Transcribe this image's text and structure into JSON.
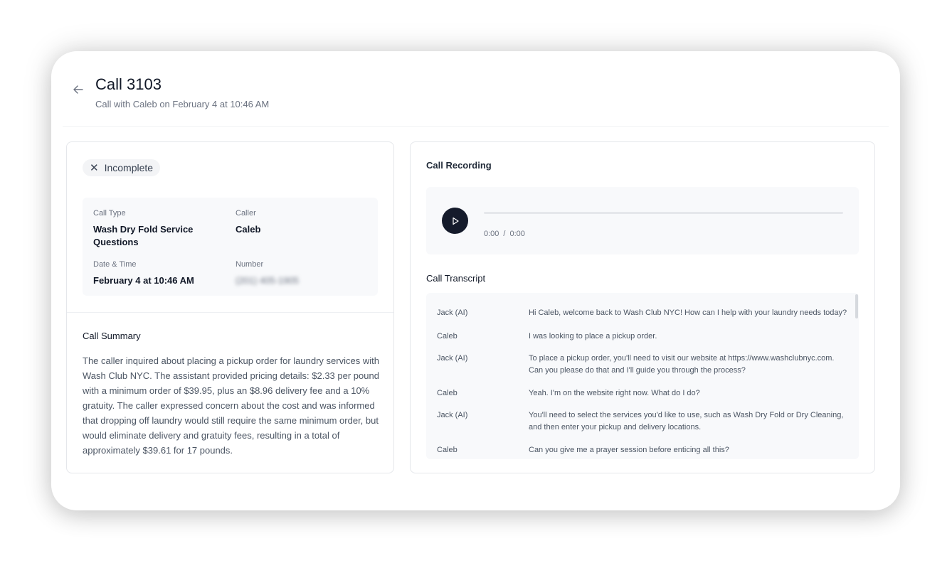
{
  "header": {
    "title": "Call 3103",
    "subtitle": "Call with Caleb on February 4 at 10:46 AM"
  },
  "status": {
    "label": "Incomplete"
  },
  "details": {
    "call_type_label": "Call Type",
    "call_type_value": "Wash Dry Fold Service Questions",
    "caller_label": "Caller",
    "caller_value": "Caleb",
    "datetime_label": "Date & Time",
    "datetime_value": "February 4 at 10:46 AM",
    "number_label": "Number",
    "number_value": "(201) 405-1905"
  },
  "summary": {
    "title": "Call Summary",
    "text": "The caller inquired about placing a pickup order for laundry services with Wash Club NYC. The assistant provided pricing details: $2.33 per pound with a minimum order of $39.95, plus an $8.96 delivery fee and a 10% gratuity. The caller expressed concern about the cost and was informed that dropping off laundry would still require the same minimum order, but would eliminate delivery and gratuity fees, resulting in a total of approximately $39.61 for 17 pounds."
  },
  "recording": {
    "title": "Call Recording",
    "current_time": "0:00",
    "separator": "/",
    "duration": "0:00",
    "progress": 0
  },
  "transcript": {
    "title": "Call Transcript",
    "rows": [
      {
        "speaker": "Jack (AI)",
        "text": "Hi Caleb, welcome back to Wash Club NYC! How can I help with your laundry needs today?"
      },
      {
        "speaker": "Caleb",
        "text": "I was looking to place a pickup order."
      },
      {
        "speaker": "Jack (AI)",
        "text": "To place a pickup order, you'll need to visit our website at https://www.washclubnyc.com. Can you please do that and I'll guide you through the process?"
      },
      {
        "speaker": "Caleb",
        "text": "Yeah. I'm on the website right now. What do I do?"
      },
      {
        "speaker": "Jack (AI)",
        "text": "You'll need to select the services you'd like to use, such as Wash Dry Fold or Dry Cleaning, and then enter your pickup and delivery locations."
      },
      {
        "speaker": "Caleb",
        "text": "Can you give me a prayer session before enticing all this?"
      }
    ]
  }
}
